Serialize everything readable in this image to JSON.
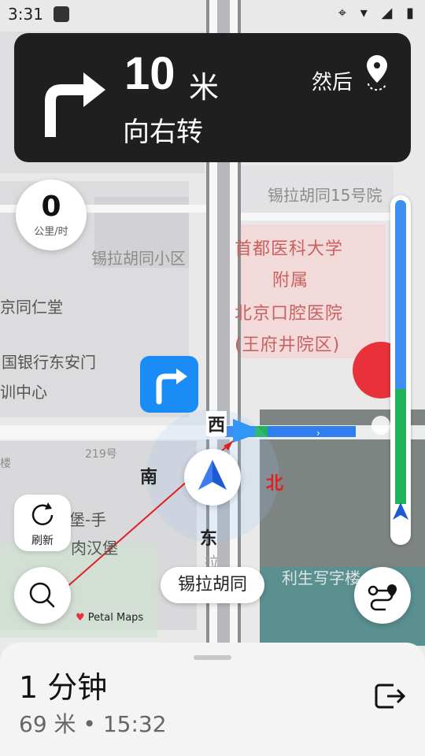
{
  "status_bar": {
    "time": "3:31",
    "icons": "⌖ ▾ ◢ ▮"
  },
  "map": {
    "labels": [
      "锡拉胡同15号院",
      "锡拉胡同小区",
      "京同仁堂",
      "国银行东安门",
      "训中心",
      "219号",
      "楼",
      "堡-手",
      "肉汉堡",
      "利生写字楼"
    ],
    "poi": [
      "首都医科大学",
      "附属",
      "北京口腔医院",
      "(王府井院区)"
    ],
    "compass": {
      "west": "西",
      "south": "南",
      "east": "东",
      "north": "北"
    },
    "road_vertical": "拉"
  },
  "nav": {
    "distance_value": "10",
    "distance_unit": "米",
    "instruction": "向右转",
    "then_label": "然后"
  },
  "speed": {
    "value": "0",
    "unit": "公里/时"
  },
  "progress": {
    "completed_fraction": 0.55
  },
  "controls": {
    "refresh_label": "刷新",
    "current_street": "锡拉胡同",
    "brand": "Petal Maps"
  },
  "bottom": {
    "eta_duration": "1 分钟",
    "eta_details": "69 米 • 15:32"
  },
  "colors": {
    "route_blue": "#2f7ef0",
    "route_green": "#1fb35a",
    "turn_badge": "#1a8cf5",
    "destination_red": "#e8313a"
  }
}
